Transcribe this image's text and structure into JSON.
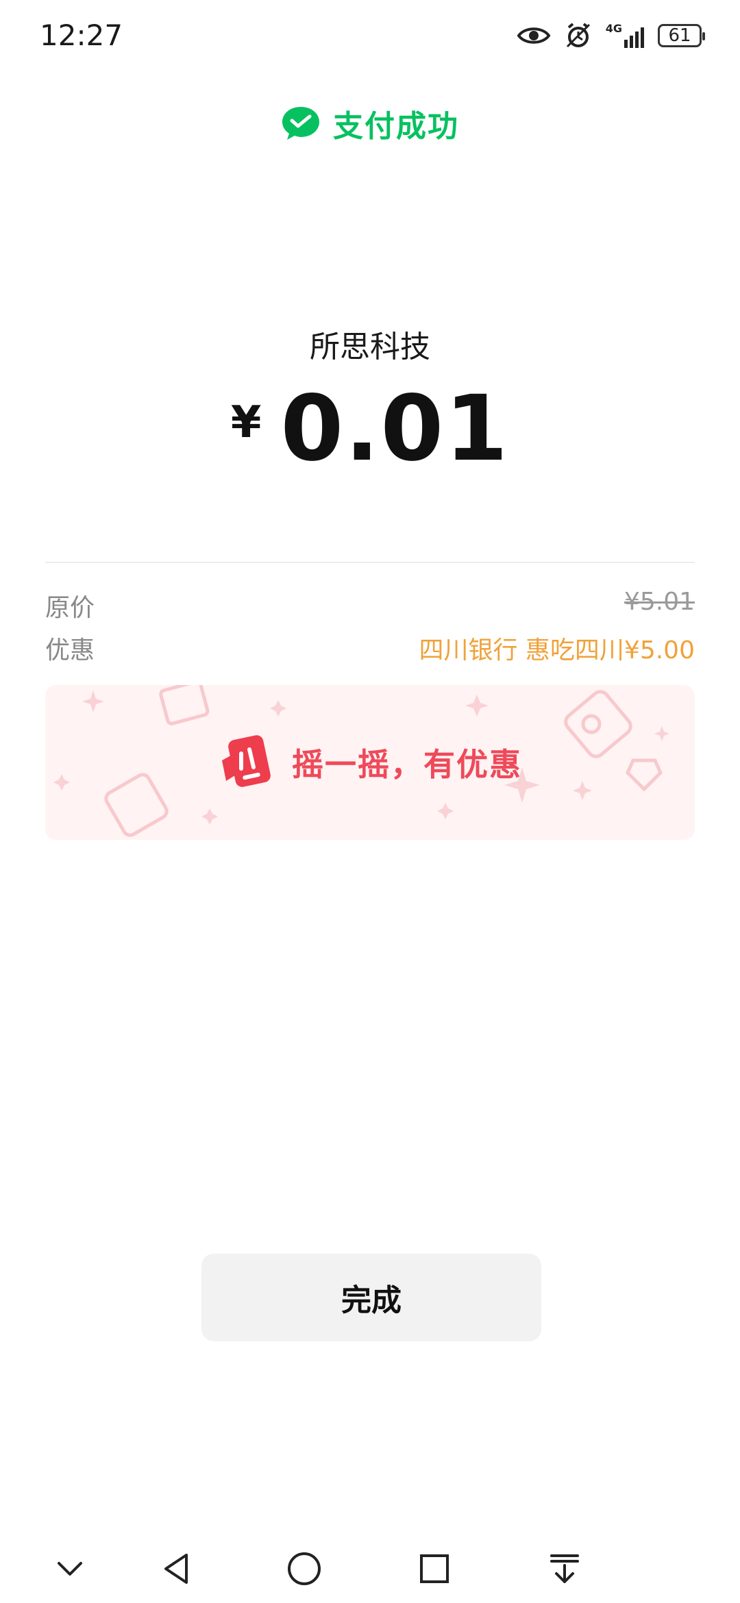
{
  "status_bar": {
    "time": "12:27",
    "network": "4G",
    "battery": "61",
    "icons": [
      "eye-icon",
      "alarm-icon",
      "signal-icon",
      "battery-icon"
    ]
  },
  "header": {
    "title": "支付成功",
    "icon": "wechat-pay-icon",
    "accent_color": "#07c160"
  },
  "payment": {
    "merchant": "所思科技",
    "currency_symbol": "¥",
    "amount": "0.01"
  },
  "details": {
    "original_label": "原价",
    "original_value": "¥5.01",
    "discount_label": "优惠",
    "discount_value": "四川银行 惠吃四川¥5.00",
    "discount_color": "#f0a23a"
  },
  "promo": {
    "text": "摇一摇，有优惠",
    "icon": "shake-phone-icon",
    "color": "#ee4a5a"
  },
  "actions": {
    "done_label": "完成"
  },
  "nav_bar": {
    "icons": [
      "collapse-icon",
      "back-icon",
      "home-icon",
      "recents-icon",
      "notification-pull-icon"
    ]
  }
}
